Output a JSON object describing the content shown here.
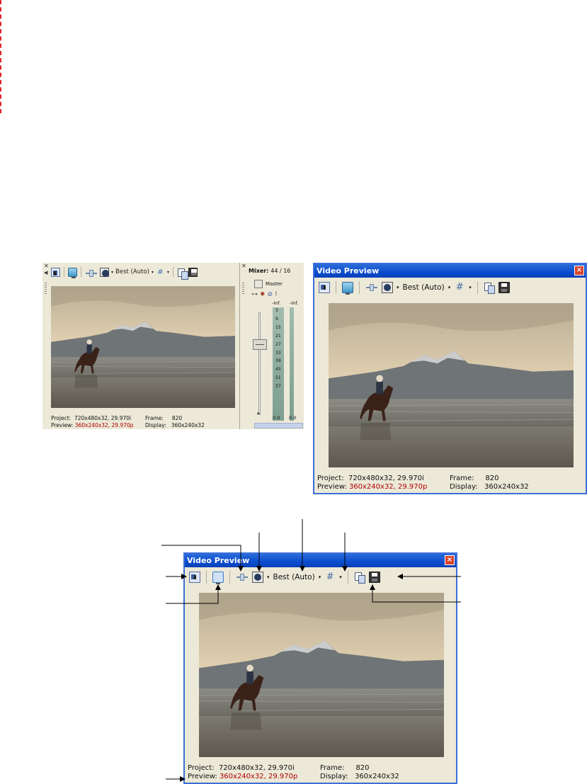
{
  "docked_view": {
    "mixer": {
      "title": "Mixer:",
      "title_value": "44 / 16",
      "channel": "Master",
      "meter_top_left": "-Inf.",
      "meter_top_right": "-Inf.",
      "meter_ticks": [
        "3",
        "9",
        "15",
        "21",
        "27",
        "33",
        "39",
        "45",
        "51",
        "57"
      ],
      "meter_bottom_left": "0.0",
      "meter_bottom_right": "0.0"
    }
  },
  "video_preview": {
    "title": "Video Preview",
    "close_glyph": "×",
    "toolbar": {
      "quality": "Best (Auto)",
      "dropdown_glyph": "▾",
      "grid_glyph": "#"
    },
    "status": {
      "project_label": "Project:",
      "project_value": "720x480x32, 29.970i",
      "frame_label": "Frame:",
      "frame_value": "820",
      "preview_label": "Preview:",
      "preview_value": "360x240x32, 29.970p",
      "display_label": "Display:",
      "display_value": "360x240x32"
    },
    "preview_value_color": "#b00000",
    "title_bar_color": "#0a4ccf"
  },
  "icons": [
    "video-output-properties-icon",
    "external-monitor-icon",
    "split-screen-icon",
    "overlay-icon",
    "grid-icon",
    "copy-snapshot-icon",
    "save-snapshot-icon"
  ]
}
